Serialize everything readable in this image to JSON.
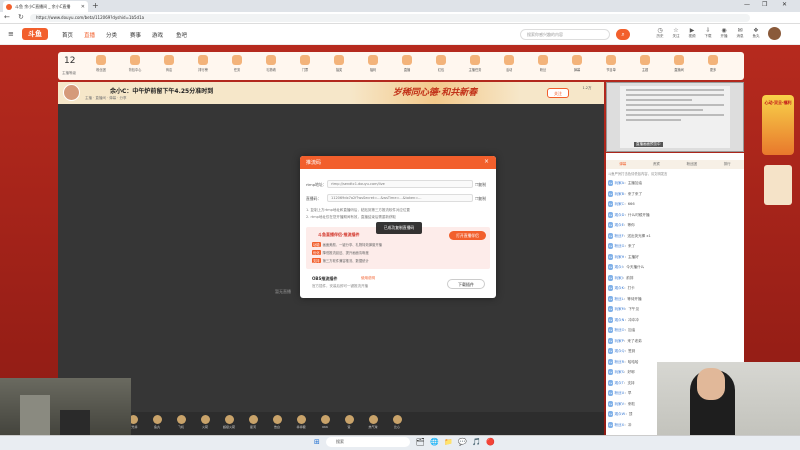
{
  "browser": {
    "tab_title": "斗鱼 余小C直播间 _ 余小C直播",
    "url": "https://www.douyu.com/beta/112069?dyshid=1b5d1a",
    "new_tab": "+",
    "window_controls": [
      "—",
      "❐",
      "✕"
    ]
  },
  "site": {
    "logo": "斗鱼",
    "nav": [
      "首页",
      "直播",
      "分类",
      "赛事",
      "游戏",
      "鱼吧"
    ],
    "search_placeholder": "搜索你感兴趣的内容",
    "header_icons": [
      {
        "icon": "clock-icon",
        "label": "历史"
      },
      {
        "icon": "star-icon",
        "label": "关注"
      },
      {
        "icon": "video-icon",
        "label": "视频"
      },
      {
        "icon": "download-icon",
        "label": "下载"
      },
      {
        "icon": "broadcast-icon",
        "label": "开播"
      },
      {
        "icon": "mail-icon",
        "label": "消息"
      },
      {
        "icon": "gift-icon",
        "label": "鱼丸"
      },
      {
        "icon": "bag-icon",
        "label": "背包"
      }
    ]
  },
  "toolbar": {
    "level": "12",
    "level_label": "主播等级",
    "tools": [
      "粉丝团",
      "背包中心",
      "商店",
      "排行榜",
      "任务",
      "礼物墙",
      "门票",
      "抽奖",
      "福利",
      "直播",
      "红包",
      "主播任务",
      "活动",
      "粉丝",
      "弹幕",
      "节目单",
      "主题",
      "直播间",
      "更多"
    ]
  },
  "room": {
    "streamer": "余小C",
    "title": "余小C：中午炉前留下午4.25分准时到",
    "meta": "主播 · 直播间 · 弹幕 · 分享",
    "banner": "岁稀同心德·和共新春",
    "follow": "关注",
    "fans_count": "1.2万",
    "no_live": "暂无直播"
  },
  "gifts": [
    "荧光棒",
    "鱼丸",
    "飞机",
    "火箭",
    "超级火箭",
    "星河",
    "告白",
    "棒棒糖",
    "666",
    "赞",
    "热气球",
    "比心"
  ],
  "stream_preview": {
    "caption": "直播画面预览中"
  },
  "chat": {
    "tabs": [
      "弹幕",
      "贵宾",
      "粉丝团",
      "排行"
    ],
    "active_tab": "弹幕",
    "notice": "斗鱼严厉打击色情低俗内容，请文明发言",
    "messages": [
      {
        "user": "玩家A",
        "text": "主播加油"
      },
      {
        "user": "玩家B",
        "text": "来了来了"
      },
      {
        "user": "玩家C",
        "text": "666"
      },
      {
        "user": "观众D",
        "text": "什么时候开播"
      },
      {
        "user": "观众E",
        "text": "等你"
      },
      {
        "user": "粉丝F",
        "text": "送出荧光棒 x1"
      },
      {
        "user": "粉丝G",
        "text": "来了"
      },
      {
        "user": "玩家H",
        "text": "主播好"
      },
      {
        "user": "观众I",
        "text": "今天播什么"
      },
      {
        "user": "玩家J",
        "text": "前排"
      },
      {
        "user": "观众K",
        "text": "打卡"
      },
      {
        "user": "粉丝L",
        "text": "等待开播"
      },
      {
        "user": "玩家M",
        "text": "下午见"
      },
      {
        "user": "观众N",
        "text": "冲冲冲"
      },
      {
        "user": "粉丝O",
        "text": "加油"
      },
      {
        "user": "玩家P",
        "text": "来了老弟"
      },
      {
        "user": "观众Q",
        "text": "签到"
      },
      {
        "user": "粉丝R",
        "text": "哈哈哈"
      },
      {
        "user": "玩家S",
        "text": "好耶"
      },
      {
        "user": "观众T",
        "text": "支持"
      },
      {
        "user": "粉丝U",
        "text": "早"
      },
      {
        "user": "玩家V",
        "text": "来啦"
      },
      {
        "user": "观众W",
        "text": "顶"
      },
      {
        "user": "粉丝X",
        "text": "冲"
      }
    ]
  },
  "promo": {
    "text": "心动·双旦·福利"
  },
  "modal": {
    "title": "推流码",
    "close": "×",
    "rtmp_label": "rtmp地址：",
    "rtmp_value": "rtmp://sendtc1.douyu.com/live",
    "key_label": "直播码：",
    "key_value": "112069dx7a2f?wsSecret=...&wsTime=...&token=...",
    "copy": "复制",
    "note1": "1. 复制上方rtmp地址和直播码后，粘贴到第三方推流软件对应位置",
    "note2": "2. rtmp地址仅在您开播期间有效，直播结束后需重新获取",
    "toast": "已成功复制直播码",
    "plugin_title": "斗鱼直播伴侣·推流插件",
    "plugin_button": "打开直播伴侣",
    "plugin_lines": [
      {
        "tag": "功能",
        "text": "画面美颜、一键分享、礼物特效弹窗开播"
      },
      {
        "tag": "优化",
        "text": "降低推流延迟、提升画面清晰度"
      },
      {
        "tag": "支持",
        "text": "第三方软件兼容推流、数据统计"
      }
    ],
    "obs_title": "OBS推流插件",
    "obs_link": "使用说明",
    "obs_desc": "官方插件，安装后即可一键推流开播",
    "download": "下载插件"
  },
  "taskbar": {
    "search": "搜索",
    "icons": [
      "🗂",
      "🌐",
      "📁",
      "💬",
      "🎵",
      "🔴"
    ]
  }
}
